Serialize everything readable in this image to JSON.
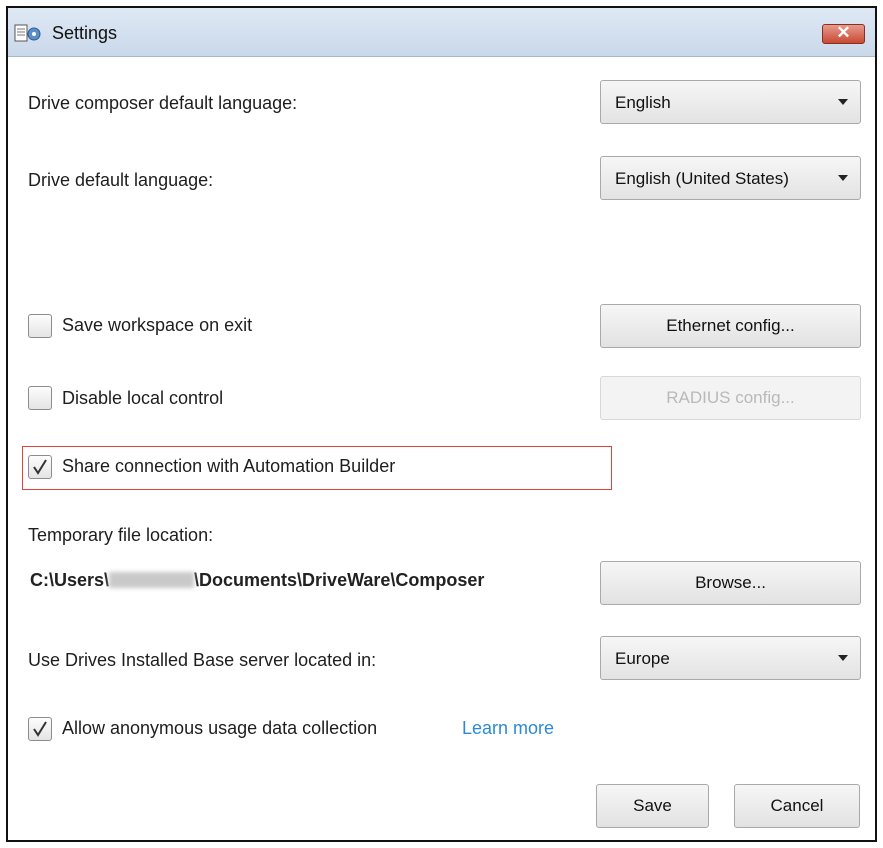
{
  "window": {
    "title": "Settings",
    "icon": "settings-app-icon",
    "close_label": "✕"
  },
  "language": {
    "composer_label": "Drive composer default language:",
    "composer_value": "English",
    "drive_label": "Drive default language:",
    "drive_value": "English (United States)"
  },
  "options": {
    "save_workspace": {
      "label": "Save workspace on exit",
      "checked": false
    },
    "disable_local": {
      "label": "Disable local control",
      "checked": false
    },
    "share_connection": {
      "label": "Share connection with Automation Builder",
      "checked": true
    },
    "anonymous_usage": {
      "label": "Allow anonymous usage data collection",
      "checked": true,
      "link": "Learn more"
    }
  },
  "buttons": {
    "ethernet": "Ethernet config...",
    "radius": "RADIUS config...",
    "browse": "Browse...",
    "save": "Save",
    "cancel": "Cancel"
  },
  "temp_location": {
    "label": "Temporary file location:",
    "path_prefix": "C:\\Users\\",
    "path_suffix": "\\Documents\\DriveWare\\Composer"
  },
  "server": {
    "label": "Use Drives Installed Base server located in:",
    "value": "Europe"
  },
  "colors": {
    "highlight": "#e0413a",
    "link": "#2b8ad6",
    "close_button": "#c84a35"
  }
}
